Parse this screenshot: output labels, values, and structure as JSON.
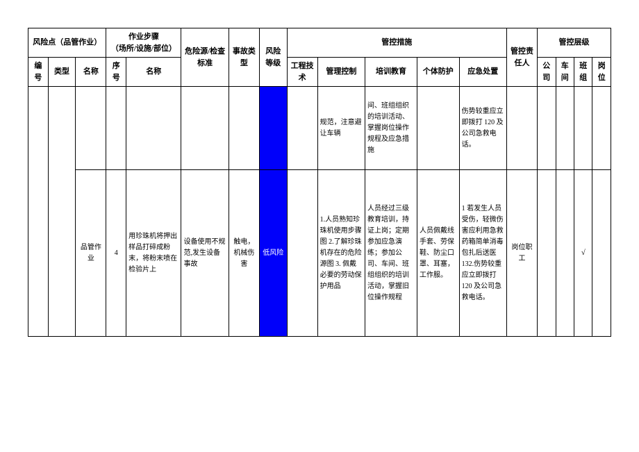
{
  "header": {
    "risk_point_group": "风险点（品管作业）",
    "step_group": "作业步骤\n（场所/设施/部位）",
    "hazard_standard": "危险源/检查标准",
    "accident_type": "事故类型",
    "risk_level": "风险等级",
    "control_measures": "管控措施",
    "responsible": "管控责任人",
    "control_level": "管控层级",
    "number": "编号",
    "type": "类型",
    "name": "名称",
    "seq": "序号",
    "step_name": "名称",
    "engineering": "工程技术",
    "management": "管理控制",
    "training": "培训教育",
    "protection": "个体防护",
    "emergency": "应急处置",
    "company": "公司",
    "workshop": "车间",
    "team": "班组",
    "post": "岗位"
  },
  "rows": {
    "r1": {
      "management": "规范，注意避让车辆",
      "training": "间、班组组织的培训活动、掌握岗位操作规程及应急措施",
      "emergency": "伤势较重应立即拨打 120 及公司急救电话。"
    },
    "r2": {
      "name": "品管作业",
      "seq": "4",
      "step_name": "用珍珠机将押出样品打碎成粉末，将粉末喷在检验片上",
      "hazard": "设备使用不规范,发生设备事故",
      "accident": "触电，机械伤害",
      "risk": "低风险",
      "management": "1.人员熟知珍珠机使用步骤图 2.了解珍珠机存在的危险源图 3. 佩戴必要的劳动保护用品",
      "training": "人员经过三级教育培训，持证上岗；定期参加应急演\n练；参加公司、车间、班组组织的培训活动，掌握旧位操作规程",
      "protection": "人员佩戴线手套、劳保鞋、防尘口罩、耳塞，工作服。",
      "emergency": "1 若发生人员受伤，轻微伤害应利用急救药箱简单消毒包扎后送医 132.伤势较重应立即拨打 120 及公司急救电话。",
      "responsible": "岗位职工",
      "team_check": "√"
    }
  }
}
